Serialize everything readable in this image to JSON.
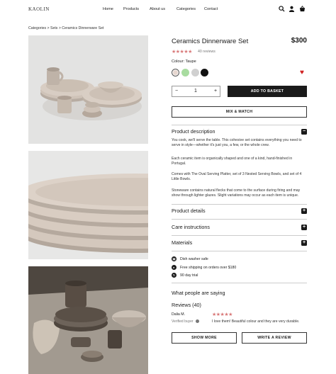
{
  "header": {
    "logo": "KAOLIN",
    "nav": [
      "Home",
      "Products",
      "About us",
      "Categories",
      "Contact"
    ],
    "icons": [
      "search-icon",
      "user-icon",
      "basket-icon"
    ]
  },
  "breadcrumb": "Categories > Sets > Ceramics Dinnerware Set",
  "product": {
    "title": "Ceramics Dinnerware Set",
    "price": "$300",
    "rating_stars": "★★★★★",
    "rating": 5,
    "reviews_count": "40 reviews",
    "colour_label": "Colour: Taupe",
    "swatches": [
      "#e6d6cf",
      "#a8dca0",
      "#d0d0d0",
      "#111111"
    ],
    "quantity": "1",
    "qty_minus": "−",
    "qty_plus": "+",
    "add_to_basket": "ADD TO BASKET",
    "mix_match": "MIX & MATCH"
  },
  "description": {
    "heading": "Product description",
    "paragraphs": [
      "You cook, we'll serve the table. This cohesive set contains everything you need to serve in style—whether it's just you, a few, or the whole crew.",
      "Each ceramic item is organically shaped and one of a kind, hand-finished in Portugal.",
      "Comes with The Oval Serving Platter, set of 3 Nested Serving Bowls, and set of 4 Little Bowls.",
      "Stoneware contains natural flecks that come to the surface during firing and may show through lighter glazes. Slight variations may occur as each item is unique."
    ]
  },
  "accordions": [
    "Product details",
    "Care instructions",
    "Materials"
  ],
  "features": [
    "Dish washer safe",
    "Free shipping on orders over $180",
    "90 day trial"
  ],
  "reviews": {
    "intro": "What people are saying",
    "title": "Reviews (40)",
    "reviewer": "Dalia M.",
    "verified": "Verified buyer",
    "stars": "★★★★★",
    "text": "I love them! Beautiful colour and they are very durable.",
    "show_more": "SHOW MORE",
    "write_review": "WRITE A REVIEW"
  },
  "colors": {
    "accent": "#1a1a1a",
    "star": "#d97a7a",
    "heart": "#d02020",
    "ceramic": "#cfc3b8"
  }
}
